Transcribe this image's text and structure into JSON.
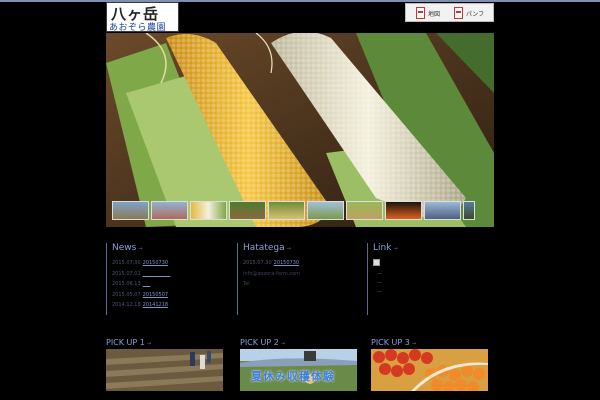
{
  "header": {
    "logo_line1": "八ヶ岳",
    "logo_line2": "あおぞら農園"
  },
  "pdf_links": [
    {
      "label": "地図"
    },
    {
      "label": "パンフ"
    }
  ],
  "hero": {
    "thumbnail_count": 10
  },
  "news": {
    "title": "News",
    "items": [
      {
        "date": "2015.07.30",
        "text": "20150730"
      },
      {
        "date": "2015.07.01",
        "text": "___________"
      },
      {
        "date": "2015.06.13",
        "text": "___"
      },
      {
        "date": "2015.05.07",
        "text": "20150507"
      },
      {
        "date": "2014.12.18",
        "text": "20141218"
      }
    ]
  },
  "hatatega": {
    "title": "Hatatega",
    "items": [
      {
        "date": "2015.07.30",
        "text": "20150730"
      }
    ],
    "email": "info@aozora-farm.com",
    "tel": "Tel"
  },
  "link": {
    "title": "Link",
    "items": [
      "—",
      "—",
      "—"
    ]
  },
  "pickups": [
    {
      "title": "PICK UP 1"
    },
    {
      "title": "PICK UP 2",
      "caption": "夏休み収穫体験"
    },
    {
      "title": "PICK UP 3"
    }
  ],
  "colors": {
    "accent": "#8aa0d8",
    "background": "#000000",
    "topbar": "#7d8fb3"
  }
}
